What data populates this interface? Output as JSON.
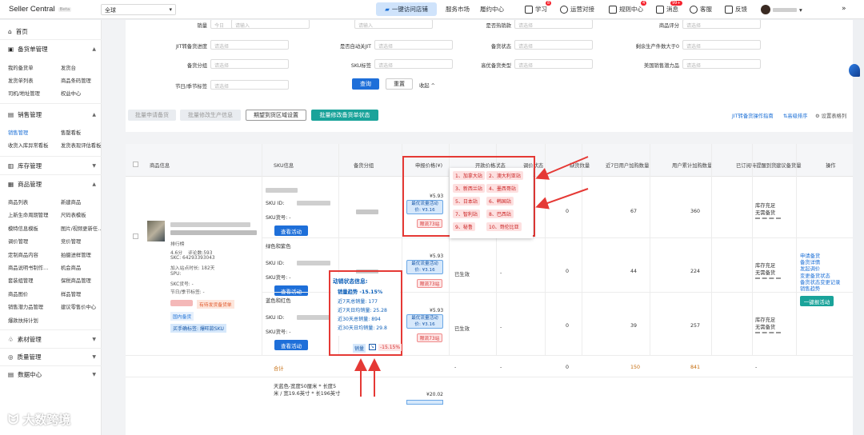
{
  "top": {
    "app_title": "Seller Central",
    "beta": "Beta",
    "region": "全球",
    "one_click": "一键访问店铺",
    "links": [
      "服务市场",
      "履约中心"
    ],
    "right": [
      {
        "label": "学习",
        "badge": "8"
      },
      {
        "label": "运营对接",
        "badge": ""
      },
      {
        "label": "规则中心",
        "badge": "4"
      },
      {
        "label": "消息",
        "badge": "99+"
      },
      {
        "label": "客服",
        "badge": ""
      },
      {
        "label": "反馈",
        "badge": ""
      }
    ]
  },
  "sidebar": {
    "home": "首页",
    "groups": [
      {
        "title": "备货单管理",
        "items": [
          "我的备货单",
          "发货台",
          "发货单列表",
          "商品条码管理",
          "司机/地址管理",
          "权益中心"
        ]
      },
      {
        "title": "销售管理",
        "items": [
          "销售管理",
          "售罄看板",
          "收货入库异常看板",
          "发货表现评估看板"
        ]
      },
      {
        "title": "库存管理",
        "items": []
      },
      {
        "title": "商品管理",
        "items": [
          "商品列表",
          "新建商品",
          "上新生命周期管理",
          "尺码表模板",
          "模特信息模板",
          "图片/视频更新任…",
          "调价管理",
          "竞价管理",
          "定制商品内容",
          "拍摄进样管理",
          "商品说明书制作…",
          "机会商品",
          "套装组管理",
          "保税商品管理",
          "商品图价",
          "样品管理",
          "销售潜力品管理",
          "建议零售价中心",
          "爆款扶持计划"
        ]
      },
      {
        "title": "素材管理",
        "items": []
      },
      {
        "title": "质量管理",
        "items": []
      },
      {
        "title": "数据中心",
        "items": []
      }
    ]
  },
  "filters": {
    "rows": [
      [
        {
          "label": "销量",
          "value": "今日"
        },
        {
          "label": "",
          "value": "请输入"
        },
        {
          "label": "",
          "value": "请输入"
        },
        {
          "label": "是否热销款",
          "value": "请选择"
        },
        {
          "label": "商品评分",
          "value": "请选择"
        }
      ],
      [
        {
          "label": "JIT转备货进度",
          "value": "请选择"
        },
        {
          "label": "是否自动关JIT",
          "value": "请选择"
        },
        {
          "label": "备货状态",
          "value": "请选择"
        },
        {
          "label": "剩余生产件数大于0",
          "value": "请选择"
        }
      ],
      [
        {
          "label": "备货分组",
          "value": "请选择"
        },
        {
          "label": "SKU标签",
          "value": "请选择"
        },
        {
          "label": "高优备货类型",
          "value": "请选择"
        },
        {
          "label": "美国销售潜力品",
          "value": "请选择"
        }
      ],
      [
        {
          "label": "节日/季节标签",
          "value": "请选择"
        }
      ]
    ],
    "search": "查询",
    "reset": "重置",
    "collapse": "收起"
  },
  "toolbar": {
    "batch_apply": "批量申请备货",
    "batch_modify": "批量修改生产信息",
    "expect_ship": "期望到货区域设置",
    "batch_stock": "批量修改备货单状态",
    "guide": "JIT转备货操作指南",
    "advanced_sort": "高级排序",
    "settings": "设置表格列"
  },
  "table": {
    "headers": [
      "商品信息",
      "SKU信息",
      "备货分组",
      "申报价格(¥)",
      "开款价格状态",
      "调价状态",
      "缺货数量",
      "近7日用户加购数量",
      "用户累计加购数量",
      "已订阅待提醒到货",
      "建议备货量",
      "操作"
    ],
    "product": {
      "rating": "4.6分",
      "reviews": "评论数:593",
      "skc": "SKC: 64293393043",
      "joined": "加入站点时长: 182天",
      "spu": "SPU:",
      "skc_code": "SKC货号: -",
      "season": "节日/季节标签: -",
      "tag": "有待发货备货单",
      "domestic": "国内备货",
      "buy_tag": "买手确标签: 爆旺款SKU",
      "rank_label": "排行榜"
    },
    "skus": [
      {
        "color": "",
        "price": "¥5.93",
        "promo1": "最优流量活动",
        "promo2": "价: ¥3.16",
        "limit": "限流73站",
        "status": "",
        "adj": "",
        "short": "0",
        "d7": "67",
        "total": "360",
        "suggest1": "库存充足",
        "suggest2": "无需备货"
      },
      {
        "color": "绿色和紫色",
        "price": "¥5.93",
        "promo1": "最优流量活动",
        "promo2": "价: ¥3.16",
        "limit": "限流73站",
        "status": "已生效",
        "adj": "-",
        "short": "0",
        "d7": "44",
        "total": "224",
        "suggest1": "库存充足",
        "suggest2": "无需备货"
      },
      {
        "color": "蓝色和红色",
        "price": "¥5.93",
        "promo1": "最优流量活动",
        "promo2": "价: ¥3.16",
        "limit": "限流73站",
        "status": "已生效",
        "adj": "-",
        "short": "0",
        "d7": "39",
        "total": "257",
        "suggest1": "库存充足",
        "suggest2": "无需备货"
      }
    ],
    "sku_id": "SKU ID:",
    "sku_code": "SKU货号: -",
    "view_activity": "查看活动",
    "total_row": {
      "label": "合计",
      "status": "-",
      "adj": "-",
      "short": "0",
      "d7": "150",
      "total": "841",
      "sub": "-"
    },
    "next": {
      "desc1": "天蓝色-宽度50厘米 * 长度5",
      "desc2": "米 / 宽19.6英寸 * 长196英寸",
      "price": "¥20.02"
    },
    "ops": [
      "申请备货",
      "备货详情",
      "发起调价",
      "变更备货状态",
      "备货状态变更记录",
      "销售趋势"
    ],
    "one_click_btn": "一键报活动"
  },
  "sites": [
    "1、加拿大站",
    "2、澳大利亚站",
    "3、新西兰站",
    "4、墨西哥站",
    "5、日本站",
    "6、韩国站",
    "7、智利站",
    "8、巴西站",
    "9、秘鲁",
    "10、哥伦比亚"
  ],
  "sales_popup": {
    "title": "动销状态信息:",
    "trend": "销量趋势 -15.15%",
    "l7": "近7天总销量: 177",
    "l7a": "近7天日均销量: 25.28",
    "l30": "近30天总销量: 894",
    "l30a": "近30天日均销量: 29.8",
    "btn": "销量",
    "pct": "-15.15%"
  },
  "watermark": "大数跨境"
}
